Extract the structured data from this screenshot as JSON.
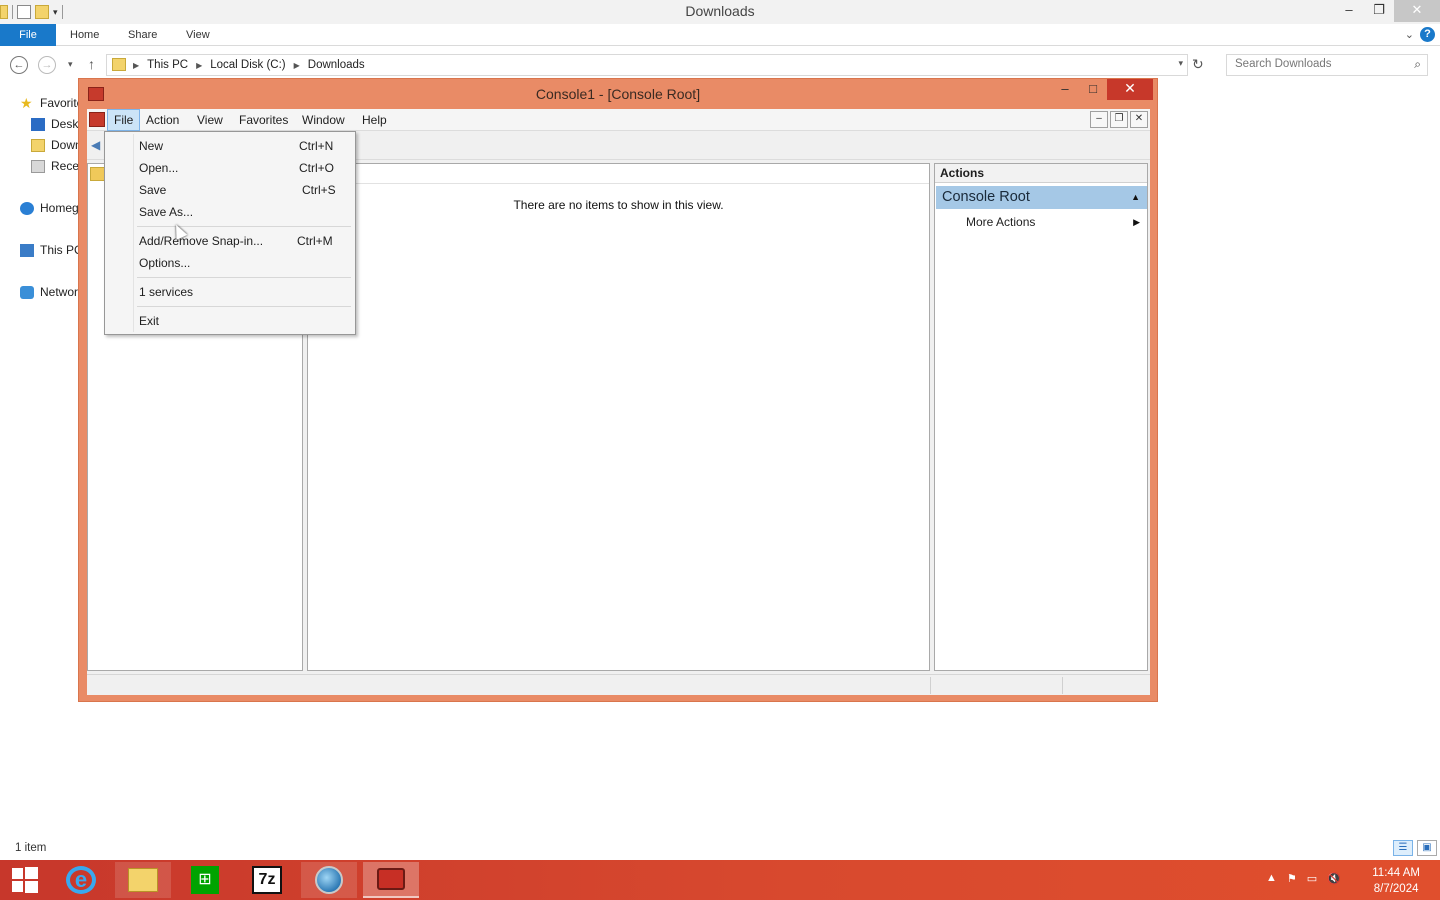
{
  "explorer": {
    "title": "Downloads",
    "ribbon_tabs": {
      "file": "File",
      "home": "Home",
      "share": "Share",
      "view": "View"
    },
    "breadcrumb": [
      "This PC",
      "Local Disk (C:)",
      "Downloads"
    ],
    "search_placeholder": "Search Downloads",
    "nav_items": [
      "Favorites",
      "Desktop",
      "Downloads",
      "Recent places",
      "Homegroup",
      "This PC",
      "Network"
    ],
    "status_count": "1 item"
  },
  "mmc": {
    "title": "Console1 - [Console Root]",
    "menu": [
      "File",
      "Action",
      "View",
      "Favorites",
      "Window",
      "Help"
    ],
    "empty_message": "There are no items to show in this view.",
    "actions": {
      "header": "Actions",
      "section": "Console Root",
      "more_actions": "More Actions"
    }
  },
  "file_menu": {
    "items": [
      {
        "label": "New",
        "shortcut": "Ctrl+N"
      },
      {
        "label": "Open...",
        "shortcut": "Ctrl+O"
      },
      {
        "label": "Save",
        "shortcut": "Ctrl+S"
      },
      {
        "label": "Save As...",
        "shortcut": ""
      },
      {
        "label": "Add/Remove Snap-in...",
        "shortcut": "Ctrl+M"
      },
      {
        "label": "Options...",
        "shortcut": ""
      },
      {
        "label": "1 services",
        "shortcut": ""
      },
      {
        "label": "Exit",
        "shortcut": ""
      }
    ]
  },
  "taskbar": {
    "time": "11:44 AM",
    "date": "8/7/2024",
    "apps": [
      "internet-explorer",
      "file-explorer",
      "store",
      "7-zip",
      "globe-app",
      "mmc-toolbox"
    ],
    "sevenz_label": "7z"
  },
  "colors": {
    "mmc_frame": "#e98b66",
    "taskbar": "#d8492e",
    "accent_blue": "#1979ca",
    "actions_section": "#a5c8e6"
  }
}
